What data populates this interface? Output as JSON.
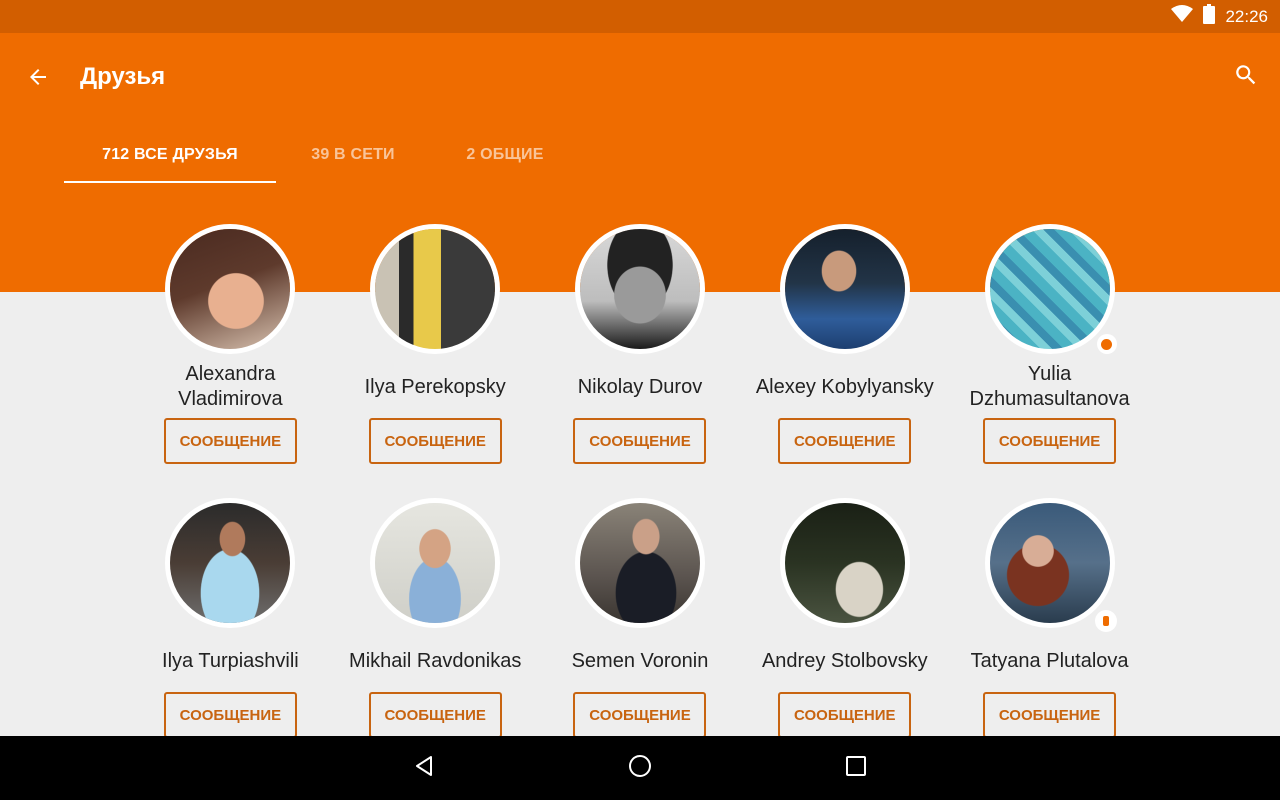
{
  "status_bar": {
    "time": "22:26",
    "wifi_icon": "wifi-icon",
    "battery_icon": "battery-icon"
  },
  "app_bar": {
    "title": "Друзья",
    "back_icon": "arrow-left-icon",
    "search_icon": "search-icon",
    "background": "#ef6c00"
  },
  "tabs": [
    {
      "label": "712 ВСЕ ДРУЗЬЯ",
      "active": true
    },
    {
      "label": "39 В СЕТИ",
      "active": false
    },
    {
      "label": "2 ОБЩИЕ",
      "active": false
    }
  ],
  "friends": [
    {
      "name": "Alexandra Vladimirova",
      "button": "СООБЩЕНИЕ",
      "status": ""
    },
    {
      "name": "Ilya Perekopsky",
      "button": "СООБЩЕНИЕ",
      "status": ""
    },
    {
      "name": "Nikolay Durov",
      "button": "СООБЩЕНИЕ",
      "status": ""
    },
    {
      "name": "Alexey Kobylyansky",
      "button": "СООБЩЕНИЕ",
      "status": ""
    },
    {
      "name": "Yulia Dzhumasultanova",
      "button": "СООБЩЕНИЕ",
      "status": "online"
    },
    {
      "name": "Ilya Turpiashvili",
      "button": "СООБЩЕНИЕ",
      "status": ""
    },
    {
      "name": "Mikhail Ravdonikas",
      "button": "СООБЩЕНИЕ",
      "status": ""
    },
    {
      "name": "Semen Voronin",
      "button": "СООБЩЕНИЕ",
      "status": ""
    },
    {
      "name": "Andrey Stolbovsky",
      "button": "СООБЩЕНИЕ",
      "status": ""
    },
    {
      "name": "Tatyana Plutalova",
      "button": "СООБЩЕНИЕ",
      "status": "mobile"
    }
  ],
  "nav_bar": {
    "back_icon": "nav-back-icon",
    "home_icon": "nav-home-icon",
    "recents_icon": "nav-recents-icon"
  },
  "colors": {
    "accent": "#ef6c00",
    "status_bar": "#d25e00",
    "button_text": "#c86410",
    "background": "#eeeeee"
  }
}
